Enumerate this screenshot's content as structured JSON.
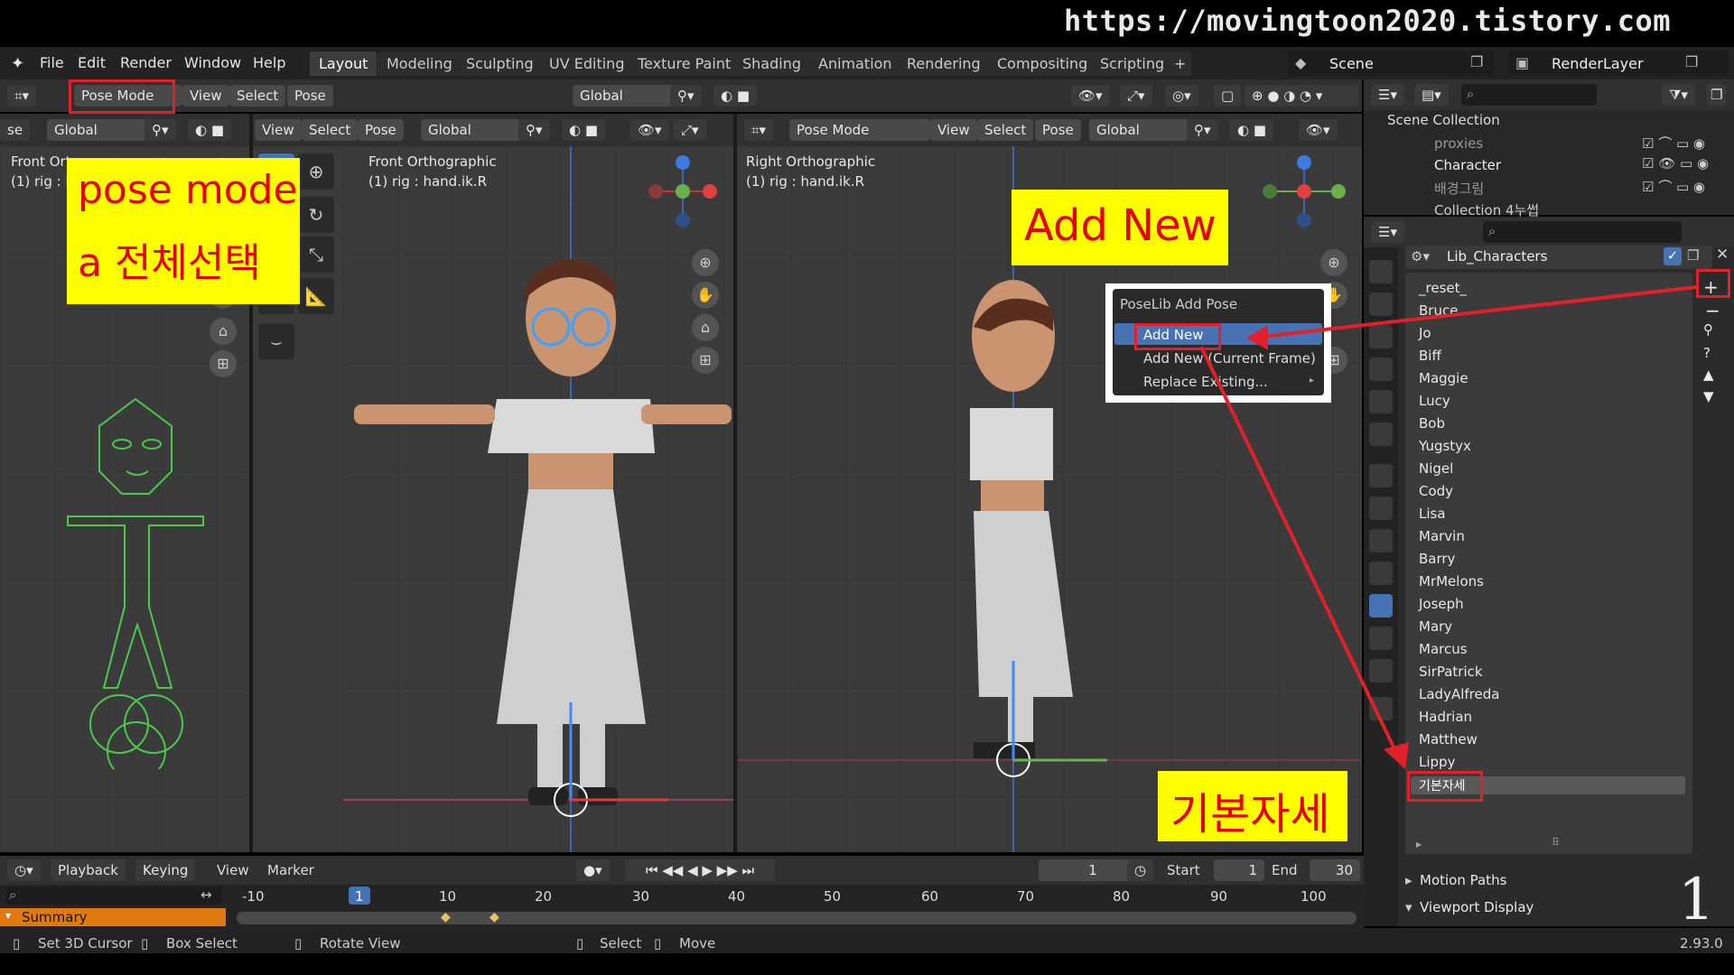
{
  "watermark_url": "https://movingtoon2020.tistory.com",
  "menu": [
    "File",
    "Edit",
    "Render",
    "Window",
    "Help"
  ],
  "workspace_tabs": [
    "Layout",
    "Modeling",
    "Sculpting",
    "UV Editing",
    "Texture Paint",
    "Shading",
    "Animation",
    "Rendering",
    "Compositing",
    "Scripting"
  ],
  "plus_label": "+",
  "scene_label": "Scene",
  "renderlayer_label": "RenderLayer",
  "header1": {
    "mode": "Pose Mode",
    "view": "View",
    "select": "Select",
    "pose": "Pose",
    "orientation": "Global"
  },
  "left_vp": {
    "header_mode": "se",
    "orientation": "Global",
    "label": "Front Ort",
    "label2": "(1) rig : h"
  },
  "mid_vp": {
    "view": "View",
    "select": "Select",
    "pose": "Pose",
    "orientation": "Global",
    "label": "Front Orthographic",
    "label2": "(1) rig : hand.ik.R"
  },
  "right_vp": {
    "mode": "Pose Mode",
    "view": "View",
    "select": "Select",
    "pose": "Pose",
    "orientation": "Global",
    "label": "Right Orthographic",
    "label2": "(1) rig : hand.ik.R"
  },
  "annotations": {
    "pose_mode_line1": "pose mode",
    "pose_mode_line2": "a 전체선택",
    "add_new": "Add New",
    "default_pose": "기본자세"
  },
  "popup": {
    "title": "PoseLib Add Pose",
    "items": [
      "Add New",
      "Add New (Current Frame)",
      "Replace Existing..."
    ]
  },
  "outliner": {
    "root": "Scene Collection",
    "items": [
      "proxies",
      "Character",
      "배경그림",
      "Collection 4누썹"
    ]
  },
  "library_name": "Lib_Characters",
  "poses": [
    "_reset_",
    "Bruce",
    "Jo",
    "Biff",
    "Maggie",
    "Lucy",
    "Bob",
    "Yugstyx",
    "Nigel",
    "Cody",
    "Lisa",
    "Marvin",
    "Barry",
    "MrMelons",
    "Joseph",
    "Mary",
    "Marcus",
    "SirPatrick",
    "LadyAlfreda",
    "Hadrian",
    "Matthew",
    "Lippy",
    "기본자세"
  ],
  "panels": [
    "Motion Paths",
    "Viewport Display"
  ],
  "timeline": {
    "playback": "Playback",
    "keying": "Keying",
    "view": "View",
    "marker": "Marker",
    "frame": "1",
    "start_label": "Start",
    "start": "1",
    "end_label": "End",
    "end": "30",
    "ticks": [
      "-10",
      "1",
      "10",
      "20",
      "30",
      "40",
      "50",
      "60",
      "70",
      "80",
      "90",
      "100"
    ],
    "summary": "Summary"
  },
  "status": {
    "set_cursor": "Set 3D Cursor",
    "box_select": "Box Select",
    "rotate": "Rotate View",
    "select": "Select",
    "move": "Move",
    "version": "2.93.0"
  },
  "page_number": "1",
  "colors": {
    "accent": "#4772b3",
    "annotation_yellow": "#ffff00",
    "annotation_red": "#e60000",
    "rig_green": "#4cc94c",
    "summary_orange": "#e07a10"
  }
}
